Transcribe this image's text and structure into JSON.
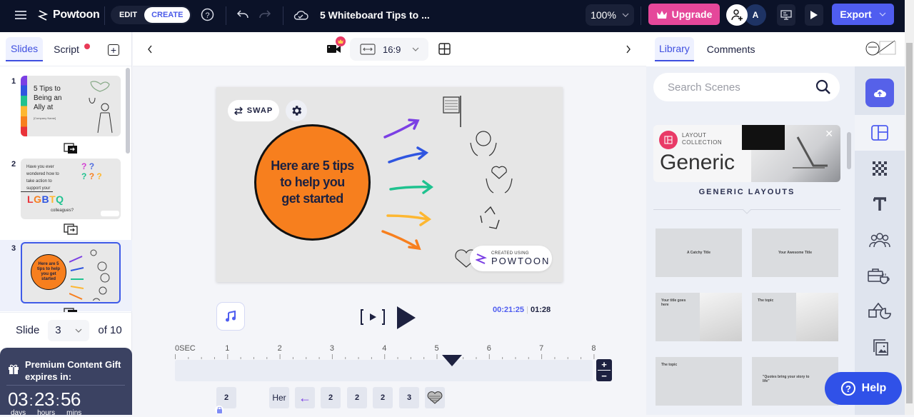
{
  "topbar": {
    "brand": "Powtoon",
    "mode_edit": "EDIT",
    "mode_create": "CREATE",
    "title": "5 Whiteboard Tips to ...",
    "zoom": "100%",
    "upgrade_label": "Upgrade",
    "avatar_initial": "A",
    "export_label": "Export"
  },
  "left_panel": {
    "tabs": [
      {
        "label": "Slides",
        "active": true
      },
      {
        "label": "Script",
        "active": false,
        "notification": true
      }
    ],
    "slides": [
      {
        "number": "1",
        "title_lines": [
          "5 Tips to",
          "Being an",
          "Ally at"
        ],
        "subtitle": "[Company Name]"
      },
      {
        "number": "2",
        "text_lines": [
          "Have you ever",
          "wondered how to",
          "take action to",
          "support your"
        ],
        "highlight": "LGBTQ",
        "tail": "colleagues?"
      },
      {
        "number": "3",
        "circle_text": "Here are 5 tips to help you get started",
        "selected": true
      }
    ],
    "slide_selector": {
      "label": "Slide",
      "current": "3",
      "of_label": "of 10"
    },
    "gift": {
      "title": "Premium Content Gift expires in:",
      "days": "03",
      "hours": "23",
      "mins": "56",
      "days_label": "days",
      "hours_label": "hours",
      "mins_label": "mins"
    }
  },
  "canvas": {
    "aspect_ratio": "16:9",
    "swap_label": "SWAP",
    "circle_text": "Here are 5 tips to help you get started",
    "watermark_small": "CREATED USING",
    "watermark_big": "POWTOON",
    "arrow_colors": [
      "#7b3fe4",
      "#2f55e0",
      "#1fc28f",
      "#fdb731",
      "#f77f1e"
    ]
  },
  "player": {
    "current_time": "00:21:25",
    "total_time": "01:28"
  },
  "timeline": {
    "ticks": [
      "0SEC",
      "1",
      "2",
      "3",
      "4",
      "5",
      "6",
      "7",
      "8"
    ],
    "playhead_seconds": 5.3,
    "chips": [
      {
        "label": "2",
        "locked": true
      },
      {
        "label": "Her"
      },
      {
        "label": "←",
        "arrow": true
      },
      {
        "label": "2"
      },
      {
        "label": "2"
      },
      {
        "label": "2"
      },
      {
        "label": "3"
      },
      {
        "label": "",
        "heart": true
      }
    ]
  },
  "right_panel": {
    "tabs": [
      {
        "label": "Library",
        "active": true
      },
      {
        "label": "Comments",
        "active": false
      }
    ],
    "search_placeholder": "Search Scenes",
    "collection": {
      "kicker_1": "LAYOUT",
      "kicker_2": "COLLECTION",
      "name": "Generic"
    },
    "section_label": "GENERIC LAYOUTS",
    "layouts": [
      {
        "title": "A Catchy Title"
      },
      {
        "title": "Your Awesome Title"
      },
      {
        "title": "Your title goes here"
      },
      {
        "title": "The topic"
      },
      {
        "title": "The topic"
      },
      {
        "title": "\"Quotes bring your story to life\""
      }
    ],
    "rail_icons": [
      "upload-icon",
      "layout-icon",
      "background-icon",
      "text-icon",
      "characters-icon",
      "props-icon",
      "shapes-icon",
      "media-icon"
    ]
  },
  "help_label": "Help"
}
